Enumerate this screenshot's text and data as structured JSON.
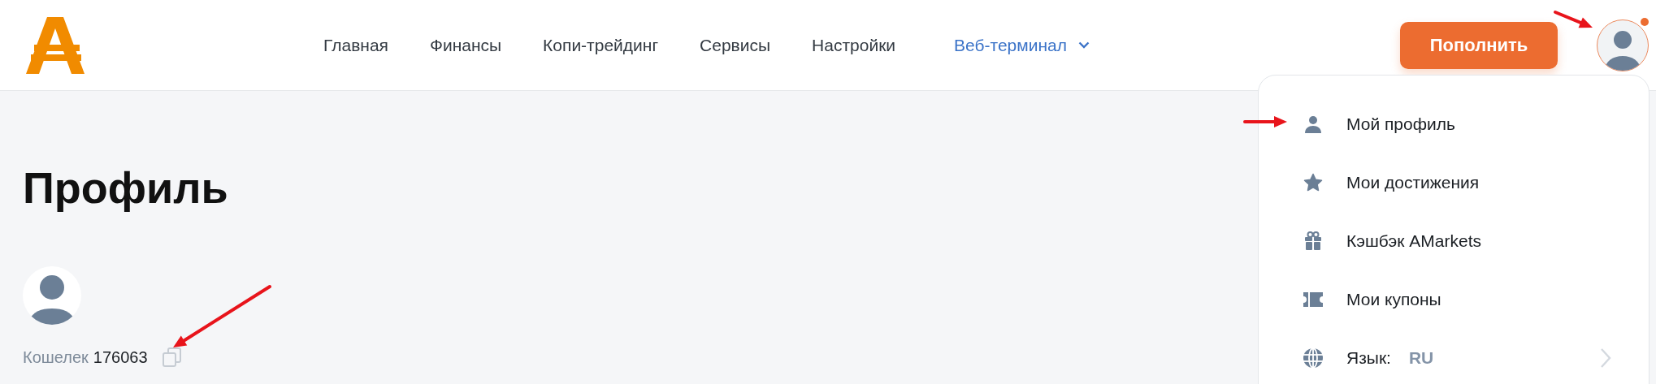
{
  "header": {
    "nav": [
      {
        "label": "Главная",
        "kind": "link"
      },
      {
        "label": "Финансы",
        "kind": "link"
      },
      {
        "label": "Копи-трейдинг",
        "kind": "link"
      },
      {
        "label": "Сервисы",
        "kind": "link"
      },
      {
        "label": "Настройки",
        "kind": "link"
      },
      {
        "label": "Веб-терминал",
        "kind": "dropdown"
      }
    ],
    "top_up_button": "Пополнить",
    "avatar": {
      "notification": true
    }
  },
  "page": {
    "title": "Профиль",
    "wallet_label": "Кошелек",
    "wallet_number": "176063"
  },
  "profile_menu": {
    "items": [
      {
        "label": "Мой профиль",
        "kind": "link"
      },
      {
        "label": "Мои достижения",
        "kind": "link"
      },
      {
        "label": "Кэшбэк AMarkets",
        "kind": "link"
      },
      {
        "label": "Мои купоны",
        "kind": "link"
      },
      {
        "label": "Язык:",
        "kind": "submenu",
        "value": "RU"
      }
    ]
  }
}
